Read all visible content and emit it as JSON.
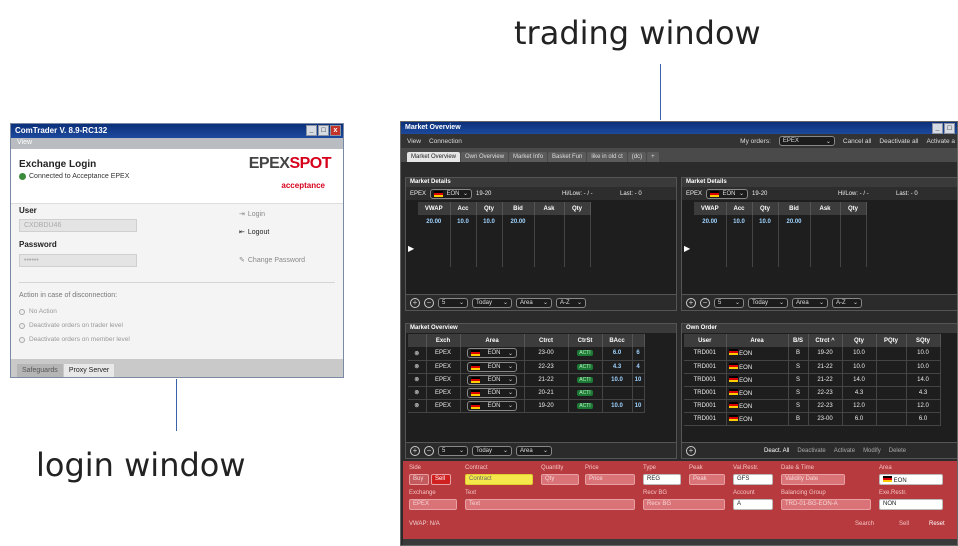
{
  "captions": {
    "trading": "trading window",
    "login": "login window"
  },
  "login": {
    "title": "ComTrader V. 8.9-RC132",
    "menu": "View",
    "heading": "Exchange Login",
    "status": "Connected to Acceptance EPEX",
    "logo_a": "EPEX",
    "logo_b": "SPOT",
    "env": "acceptance",
    "user_label": "User",
    "user_value": "CXDBDU46",
    "password_label": "Password",
    "password_value": "••••••",
    "login_btn": "Login",
    "logout_btn": "Logout",
    "change_pw_btn": "Change Password",
    "action_label": "Action in case of disconnection:",
    "options": [
      "No Action",
      "Deactivate orders on trader level",
      "Deactivate orders on member level"
    ],
    "tabs": [
      "Safeguards",
      "Proxy Server"
    ]
  },
  "trading": {
    "title": "Market Overview",
    "menu": [
      "View",
      "Connection"
    ],
    "my_orders_label": "My orders:",
    "my_orders_value": "EPEX",
    "cancel_all": "Cancel all",
    "deactivate_all": "Deactivate all",
    "activate": "Activate a",
    "tabs": [
      "Market Overview",
      "Own Overview",
      "Market Info",
      "Basket Fun",
      "like in old ct",
      "(dc)",
      "+"
    ],
    "md": {
      "title": "Market Details",
      "exch": "EPEX",
      "area": "EON",
      "contract": "19-20",
      "hilow": "Hi/Low: - / -",
      "last": "Last: - 0",
      "cols": [
        "VWAP",
        "Acc",
        "Qty",
        "Bid",
        "Ask",
        "Qty"
      ],
      "row": [
        "20.00",
        "10.0",
        "10.0",
        "20.00"
      ]
    },
    "md_footer": {
      "n": "5",
      "day": "Today",
      "area": "Area",
      "sort": "A-Z"
    },
    "mo": {
      "title": "Market Overview",
      "cols": [
        "Exch",
        "Area",
        "Ctrct",
        "CtrSt",
        "BAcc"
      ],
      "rows": [
        [
          "EPEX",
          "EON",
          "23-00",
          "ACTI",
          "6.0",
          "6"
        ],
        [
          "EPEX",
          "EON",
          "22-23",
          "ACTI",
          "4.3",
          "4"
        ],
        [
          "EPEX",
          "EON",
          "21-22",
          "ACTI",
          "10.0",
          "10"
        ],
        [
          "EPEX",
          "EON",
          "20-21",
          "ACTI",
          "",
          ""
        ],
        [
          "EPEX",
          "EON",
          "19-20",
          "ACTI",
          "10.0",
          "10"
        ]
      ]
    },
    "oo": {
      "title": "Own Order",
      "cols": [
        "User",
        "Area",
        "B/S",
        "Ctrct ^",
        "Qty",
        "PQty",
        "SQty"
      ],
      "rows": [
        [
          "TRD001",
          "EON",
          "B",
          "19-20",
          "10.0",
          "10.0"
        ],
        [
          "TRD001",
          "EON",
          "S",
          "21-22",
          "10.0",
          "10.0"
        ],
        [
          "TRD001",
          "EON",
          "S",
          "21-22",
          "14.0",
          "14.0"
        ],
        [
          "TRD001",
          "EON",
          "S",
          "22-23",
          "4.3",
          "4.3"
        ],
        [
          "TRD001",
          "EON",
          "S",
          "22-23",
          "12.0",
          "12.0"
        ],
        [
          "TRD001",
          "EON",
          "B",
          "23-00",
          "6.0",
          "6.0"
        ]
      ],
      "deact_all": "Deact. All",
      "deactivate": "Deactivate",
      "activate": "Activate",
      "modify": "Modify",
      "delete": "Delete"
    },
    "entry": {
      "side": "Side",
      "buy": "Buy",
      "sell": "Sell",
      "contract": "Contract",
      "contract_ph": "Contract",
      "quantity": "Quantity",
      "qty_ph": "Qty",
      "price": "Price",
      "price_ph": "Price",
      "type": "Type",
      "type_val": "REG",
      "peak": "Peak",
      "peak_ph": "Peak",
      "val_restr": "Val.Restr.",
      "val_val": "GFS",
      "date_time": "Date & Time",
      "date_ph": "Validity Date",
      "area": "Area",
      "area_val": "EON",
      "exchange": "Exchange",
      "exch_val": "EPEX",
      "text": "Text",
      "text_ph": "Text",
      "recv_bg": "Recv BG",
      "recv_ph": "Recv BG",
      "account": "Account",
      "acct_val": "A",
      "bal_group": "Balancing Group",
      "bal_ph": "TRD-01-BG-EON-A",
      "exe_restr": "Exe.Restr.",
      "exe_val": "NON",
      "vwap": "VWAP: N/A",
      "search": "Search",
      "sell_btn": "Sell",
      "reset": "Reset"
    }
  }
}
